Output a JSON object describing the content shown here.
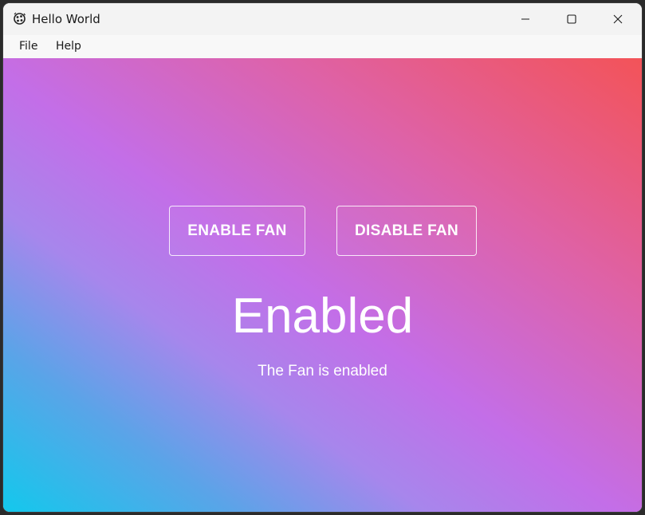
{
  "window": {
    "title": "Hello World"
  },
  "menu": {
    "items": [
      {
        "label": "File"
      },
      {
        "label": "Help"
      }
    ]
  },
  "main": {
    "enable_button": "ENABLE FAN",
    "disable_button": "DISABLE FAN",
    "status": "Enabled",
    "message": "The Fan is enabled"
  },
  "colors": {
    "gradient": [
      "#13c8ec",
      "#5aa4e8",
      "#a786ec",
      "#c36ee8",
      "#de62a8",
      "#f35358"
    ]
  }
}
